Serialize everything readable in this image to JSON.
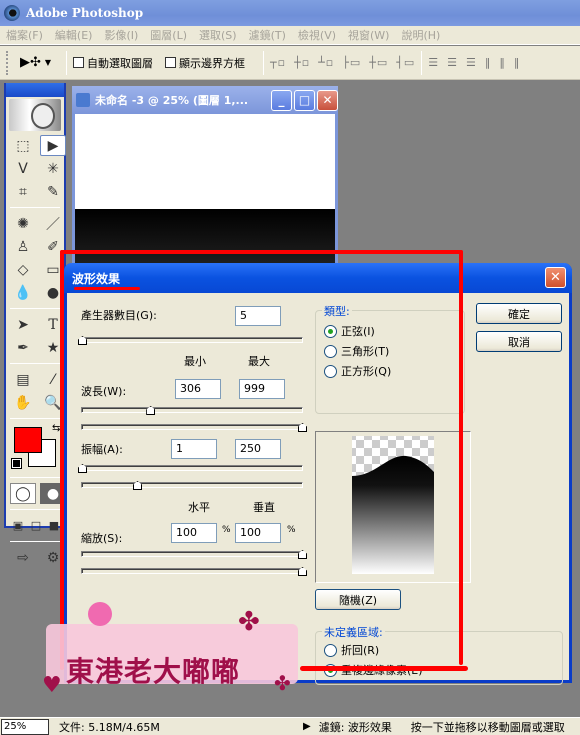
{
  "app": {
    "title": "Adobe Photoshop",
    "icon": "photoshop-eye-icon"
  },
  "menubar": [
    "檔案(F)",
    "編輯(E)",
    "影像(I)",
    "圖層(L)",
    "選取(S)",
    "濾鏡(T)",
    "檢視(V)",
    "視窗(W)",
    "說明(H)"
  ],
  "options_bar": {
    "tool_preset_icon": "move-tool-icon",
    "auto_select_layer": {
      "label": "自動選取圖層",
      "checked": false
    },
    "show_bounding_box": {
      "label": "顯示邊界方框",
      "checked": false
    },
    "align_icons": [
      "align-top-icon",
      "align-vcenter-icon",
      "align-bottom-icon",
      "align-left-icon",
      "align-hcenter-icon",
      "align-right-icon"
    ],
    "distribute_icons": [
      "distribute-top-icon",
      "distribute-vcenter-icon",
      "distribute-bottom-icon",
      "distribute-left-icon",
      "distribute-hcenter-icon",
      "distribute-right-icon"
    ]
  },
  "toolbox": {
    "tools": [
      "marquee",
      "move",
      "lasso",
      "magic-wand",
      "crop",
      "slice",
      "healing-brush",
      "brush",
      "clone-stamp",
      "history-brush",
      "eraser",
      "gradient",
      "blur",
      "dodge",
      "path-selection",
      "type",
      "pen",
      "custom-shape",
      "notes",
      "eyedropper",
      "hand",
      "zoom"
    ],
    "selected_tool": "move",
    "foreground_color": "#ff0000",
    "background_color": "#ffffff"
  },
  "document": {
    "title": "未命名 -3 @ 25% (圖層 1,...",
    "buttons": [
      "minimize",
      "maximize",
      "close"
    ]
  },
  "dialog": {
    "title": "波形效果",
    "generators_label": "產生器數目(G):",
    "generators_value": "5",
    "generators_slider": 0.0,
    "min_label": "最小",
    "max_label": "最大",
    "wavelength_label": "波長(W):",
    "wavelength_min": "306",
    "wavelength_max": "999",
    "wavelength_slider_min": 0.31,
    "wavelength_slider_max": 1.0,
    "amplitude_label": "振幅(A):",
    "amplitude_min": "1",
    "amplitude_max": "250",
    "amplitude_slider_min": 0.0,
    "amplitude_slider_max": 0.25,
    "horizontal_label": "水平",
    "vertical_label": "垂直",
    "scale_label": "縮放(S):",
    "scale_h": "100",
    "scale_v": "100",
    "percent": "%",
    "scale_slider_h": 1.0,
    "scale_slider_v": 1.0,
    "type_group": "類型:",
    "types": [
      {
        "label": "正弦(I)",
        "selected": true
      },
      {
        "label": "三角形(T)",
        "selected": false
      },
      {
        "label": "正方形(Q)",
        "selected": false
      }
    ],
    "ok": "確定",
    "cancel": "取消",
    "randomize": "隨機(Z)",
    "undefined_group": "未定義區域:",
    "undefined_options": [
      {
        "label": "折回(R)",
        "selected": false
      },
      {
        "label": "重複邊緣像素(E)",
        "selected": true
      }
    ]
  },
  "watermark": {
    "text": "東港老大嘟嘟"
  },
  "statusbar": {
    "zoom": "25%",
    "doc_size": "文件: 5.18M/4.65M",
    "filter_info": "濾鏡: 波形效果",
    "hint": "按一下並拖移以移動圖層或選取"
  },
  "annotation_color": "#ff0000"
}
